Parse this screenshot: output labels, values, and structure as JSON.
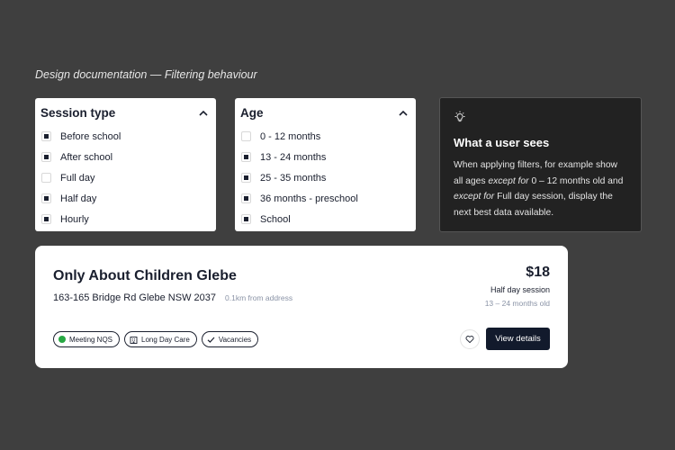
{
  "doc_title": "Design documentation — Filtering behaviour",
  "session_filter": {
    "title": "Session type",
    "options": [
      {
        "label": "Before school",
        "checked": true
      },
      {
        "label": "After school",
        "checked": true
      },
      {
        "label": "Full day",
        "checked": false
      },
      {
        "label": "Half day",
        "checked": true
      },
      {
        "label": "Hourly",
        "checked": true
      }
    ]
  },
  "age_filter": {
    "title": "Age",
    "options": [
      {
        "label": "0 - 12 months",
        "checked": false
      },
      {
        "label": "13 - 24 months",
        "checked": true
      },
      {
        "label": "25 - 35 months",
        "checked": true
      },
      {
        "label": "36 months - preschool",
        "checked": true
      },
      {
        "label": "School",
        "checked": true
      }
    ]
  },
  "info": {
    "icon": "lightbulb-icon",
    "title": "What a user sees",
    "body_1": "When applying filters, for example show all ages ",
    "body_em_1": "except for",
    "body_2": " 0 – 12 months old and ",
    "body_em_2": "except for",
    "body_3": " Full day session, display the next best data available."
  },
  "card": {
    "name": "Only About Children Glebe",
    "address": "163-165 Bridge Rd Glebe NSW 2037",
    "distance": "0.1km from address",
    "price": "$18",
    "session": "Half day session",
    "age": "13 – 24 months old",
    "tags": [
      {
        "label": "Meeting NQS",
        "icon": "green-dot-icon"
      },
      {
        "label": "Long Day Care",
        "icon": "building-icon"
      },
      {
        "label": "Vacancies",
        "icon": "check-icon"
      }
    ],
    "favorite_icon": "heart-icon",
    "cta": "View details"
  },
  "colors": {
    "background": "#3f3f3f",
    "primary": "#121a2c",
    "nqs_green": "#27a843"
  }
}
